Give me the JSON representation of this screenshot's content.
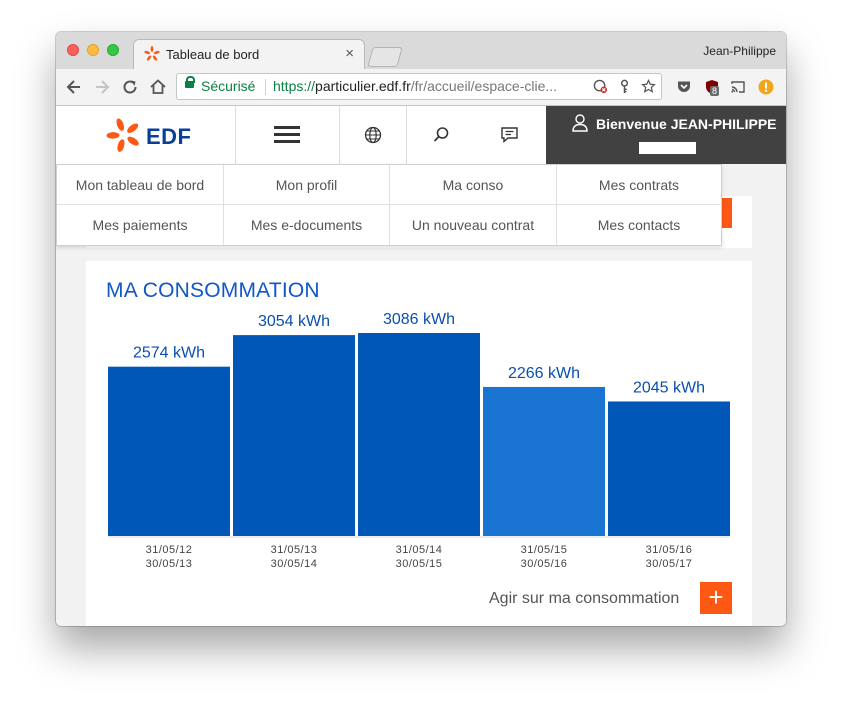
{
  "browser": {
    "tab_title": "Tableau de bord",
    "tab_close": "×",
    "profile_name": "Jean-Philippe",
    "secure_label": "Sécurisé",
    "url_scheme": "https://",
    "url_host": "particulier.edf.fr",
    "url_path": "/fr/accueil/espace-clie...",
    "extension_badge": "8"
  },
  "site": {
    "logo_text": "EDF",
    "welcome_text": "Bienvenue JEAN-PHILIPPE",
    "menu": [
      [
        "Mon tableau de bord",
        "Mon profil",
        "Ma conso",
        "Mes contrats"
      ],
      [
        "Mes paiements",
        "Mes e-documents",
        "Un nouveau contrat",
        "Mes contacts"
      ]
    ]
  },
  "consumption": {
    "title": "MA CONSOMMATION",
    "cta_label": "Agir sur ma consommation",
    "cta_icon": "+"
  },
  "chart_data": {
    "type": "bar",
    "categories": [
      [
        "31/05/12",
        "30/05/13"
      ],
      [
        "31/05/13",
        "30/05/14"
      ],
      [
        "31/05/14",
        "30/05/15"
      ],
      [
        "31/05/15",
        "30/05/16"
      ],
      [
        "31/05/16",
        "30/05/17"
      ]
    ],
    "values": [
      2574,
      3054,
      3086,
      2266,
      2045
    ],
    "value_labels": [
      "2574 kWh",
      "3054 kWh",
      "3086 kWh",
      "2266 kWh",
      "2045 kWh"
    ],
    "unit": "kWh",
    "ylim": [
      0,
      3086
    ],
    "highlighted_index": 3,
    "colors": {
      "bar": "#0057b8",
      "bar_highlight": "#1a75d2",
      "label": "#0a4fb0"
    },
    "grid": false
  },
  "colors": {
    "accent_orange": "#fe5815",
    "edf_blue": "#0a3f99",
    "header_dark": "#414141"
  }
}
